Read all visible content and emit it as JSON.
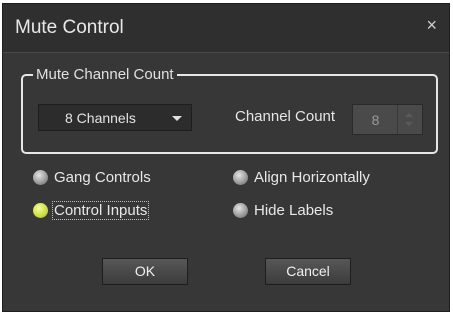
{
  "dialog": {
    "title": "Mute Control",
    "close_glyph": "×"
  },
  "group": {
    "legend": "Mute Channel Count",
    "select_value": "8 Channels",
    "count_label": "Channel Count",
    "count_value": "8"
  },
  "options": {
    "gang_controls": "Gang Controls",
    "align_horizontally": "Align Horizontally",
    "control_inputs": "Control Inputs",
    "hide_labels": "Hide Labels"
  },
  "buttons": {
    "ok": "OK",
    "cancel": "Cancel"
  },
  "colors": {
    "background": "#373737",
    "selected_radio": "#c8d83e"
  }
}
